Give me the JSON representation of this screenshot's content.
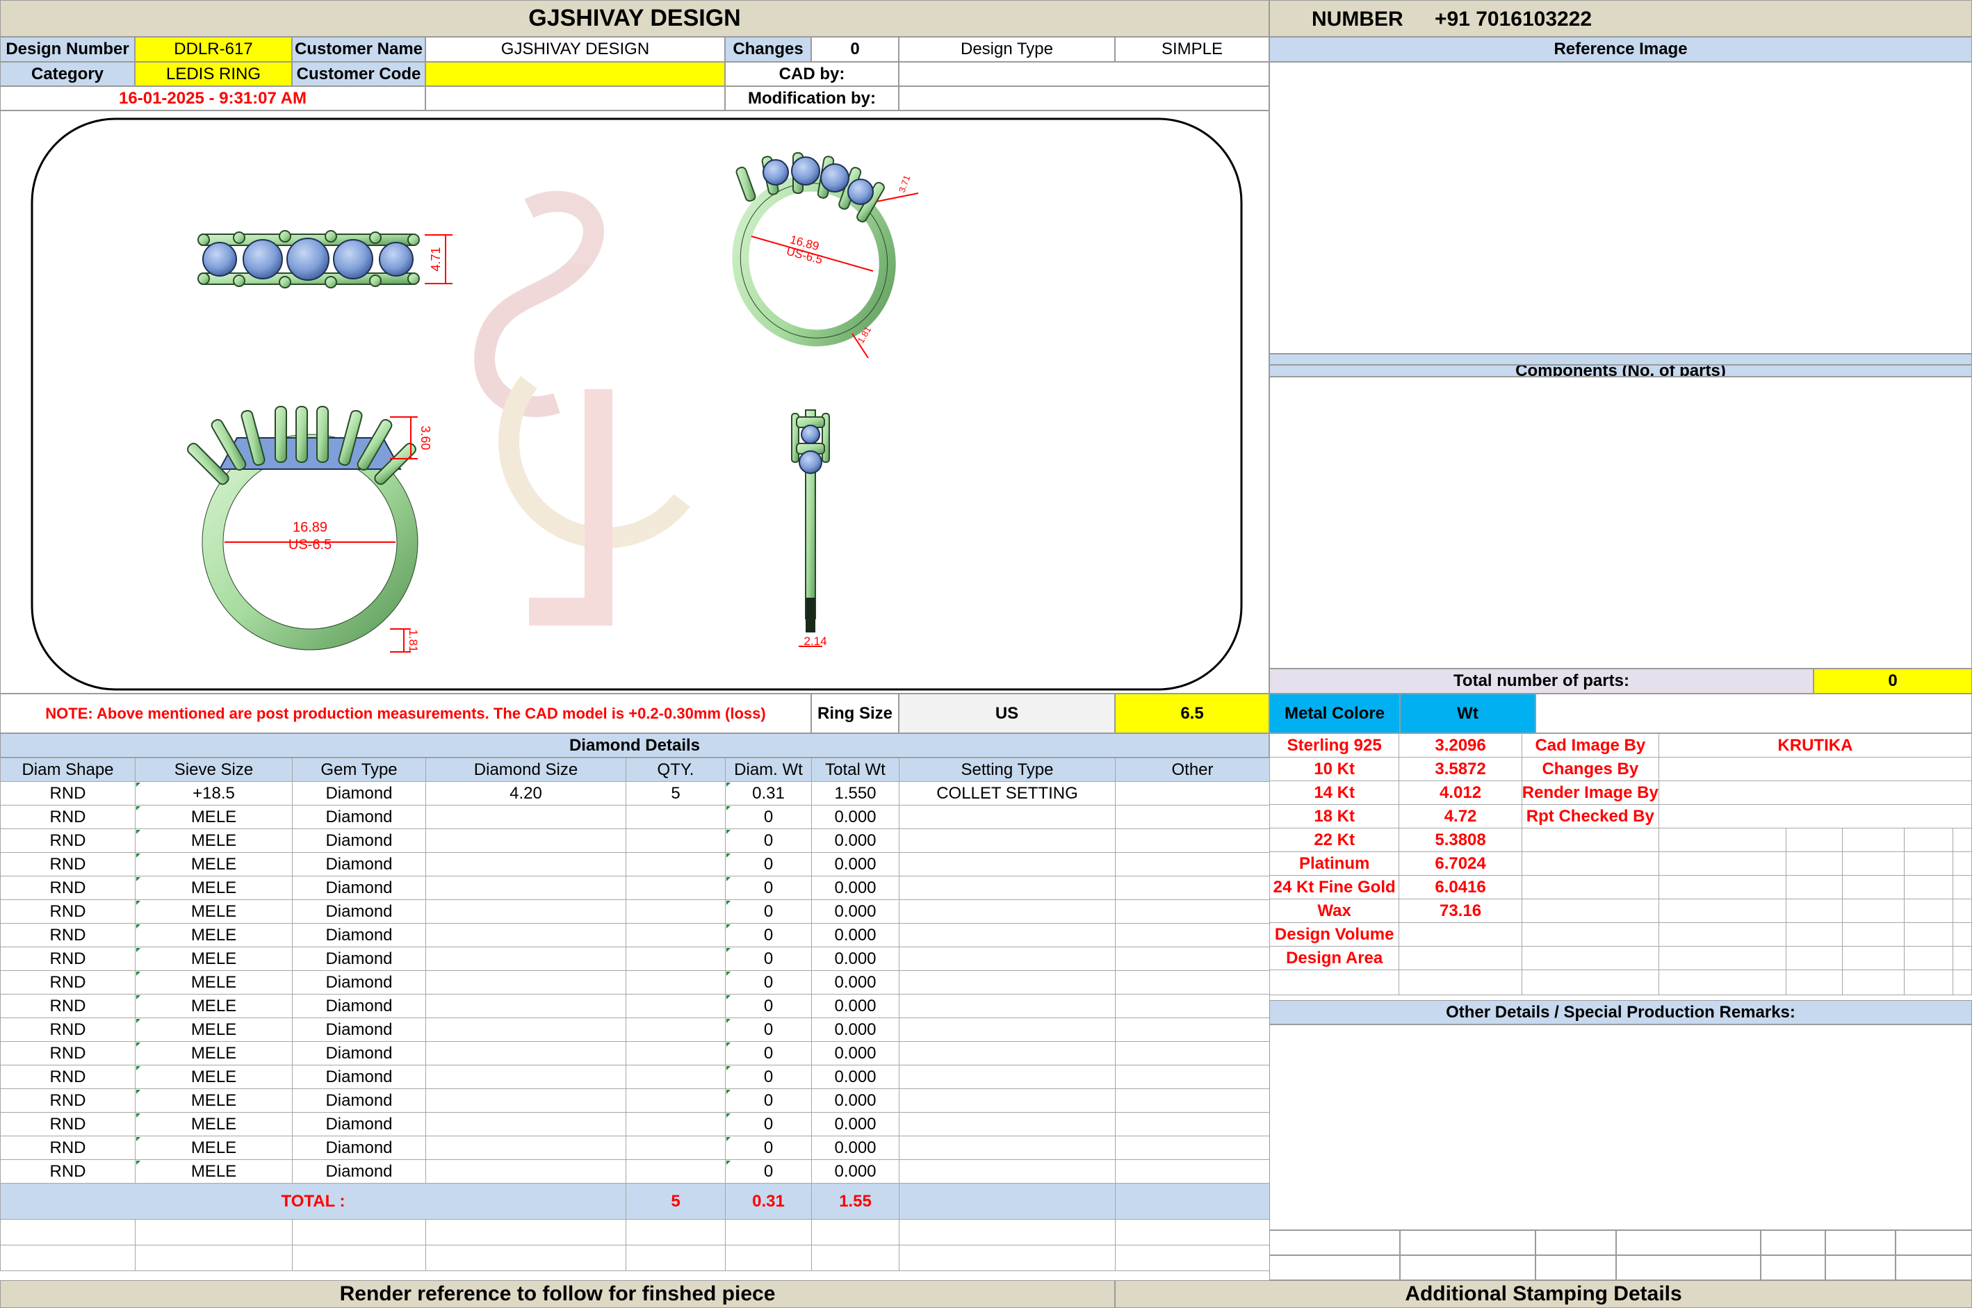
{
  "header": {
    "company": "GJSHIVAY DESIGN",
    "number_label": "NUMBER",
    "number_value": "+91 7016103222"
  },
  "info": {
    "design_number_label": "Design Number",
    "design_number": "DDLR-617",
    "customer_name_label": "Customer Name",
    "customer_name": "GJSHIVAY DESIGN",
    "changes_label": "Changes",
    "changes": "0",
    "design_type_label": "Design Type",
    "design_type": "SIMPLE",
    "category_label": "Category",
    "category": "LEDIS RING",
    "customer_code_label": "Customer Code",
    "customer_code": "",
    "cad_by_label": "CAD by:",
    "cad_by": "",
    "modification_label": "Modification by:",
    "modification": "",
    "datetime": "16-01-2025 - 9:31:07 AM"
  },
  "cad_labels": {
    "top_height": "4.71",
    "persp_diameter": "16.89",
    "persp_size": "US-6.5",
    "front_height": "3.60",
    "front_diameter": "16.89",
    "front_size": "US-6.5",
    "front_shank": "1.81",
    "side_width": "2.14",
    "persp_small": "1.81",
    "persp_tiny": "3.71"
  },
  "right_panel": {
    "reference_image": "Reference Image",
    "components": "Components (No. of parts)",
    "total_parts_label": "Total number of parts:",
    "total_parts": "0",
    "other_details": "Other Details / Special Production Remarks:"
  },
  "note": "NOTE: Above mentioned are post production measurements. The CAD model is +0.2-0.30mm (loss)",
  "ring_size": {
    "label": "Ring Size",
    "unit": "US",
    "value": "6.5"
  },
  "diamond": {
    "title": "Diamond Details",
    "headers": [
      "Diam Shape",
      "Sieve Size",
      "Gem Type",
      "Diamond Size",
      "QTY.",
      "Diam. Wt",
      "Total Wt",
      "Setting Type",
      "Other"
    ],
    "rows": [
      [
        "RND",
        "+18.5",
        "Diamond",
        "4.20",
        "5",
        "0.31",
        "1.550",
        "COLLET SETTING",
        ""
      ],
      [
        "RND",
        "MELE",
        "Diamond",
        "",
        "",
        "0",
        "0.000",
        "",
        ""
      ],
      [
        "RND",
        "MELE",
        "Diamond",
        "",
        "",
        "0",
        "0.000",
        "",
        ""
      ],
      [
        "RND",
        "MELE",
        "Diamond",
        "",
        "",
        "0",
        "0.000",
        "",
        ""
      ],
      [
        "RND",
        "MELE",
        "Diamond",
        "",
        "",
        "0",
        "0.000",
        "",
        ""
      ],
      [
        "RND",
        "MELE",
        "Diamond",
        "",
        "",
        "0",
        "0.000",
        "",
        ""
      ],
      [
        "RND",
        "MELE",
        "Diamond",
        "",
        "",
        "0",
        "0.000",
        "",
        ""
      ],
      [
        "RND",
        "MELE",
        "Diamond",
        "",
        "",
        "0",
        "0.000",
        "",
        ""
      ],
      [
        "RND",
        "MELE",
        "Diamond",
        "",
        "",
        "0",
        "0.000",
        "",
        ""
      ],
      [
        "RND",
        "MELE",
        "Diamond",
        "",
        "",
        "0",
        "0.000",
        "",
        ""
      ],
      [
        "RND",
        "MELE",
        "Diamond",
        "",
        "",
        "0",
        "0.000",
        "",
        ""
      ],
      [
        "RND",
        "MELE",
        "Diamond",
        "",
        "",
        "0",
        "0.000",
        "",
        ""
      ],
      [
        "RND",
        "MELE",
        "Diamond",
        "",
        "",
        "0",
        "0.000",
        "",
        ""
      ],
      [
        "RND",
        "MELE",
        "Diamond",
        "",
        "",
        "0",
        "0.000",
        "",
        ""
      ],
      [
        "RND",
        "MELE",
        "Diamond",
        "",
        "",
        "0",
        "0.000",
        "",
        ""
      ],
      [
        "RND",
        "MELE",
        "Diamond",
        "",
        "",
        "0",
        "0.000",
        "",
        ""
      ],
      [
        "RND",
        "MELE",
        "Diamond",
        "",
        "",
        "0",
        "0.000",
        "",
        ""
      ]
    ],
    "total_label": "TOTAL :",
    "total_qty": "5",
    "total_diam_wt": "0.31",
    "total_wt": "1.55"
  },
  "metal": {
    "header_label": "Metal Colore",
    "header_wt": "Wt",
    "rows": [
      [
        "Sterling 925",
        "3.2096"
      ],
      [
        "10 Kt",
        "3.5872"
      ],
      [
        "14 Kt",
        "4.012"
      ],
      [
        "18 Kt",
        "4.72"
      ],
      [
        "22 Kt",
        "5.3808"
      ],
      [
        "Platinum",
        "6.7024"
      ],
      [
        "24 Kt Fine Gold",
        "6.0416"
      ],
      [
        "Wax",
        "73.16"
      ],
      [
        "Design Volume",
        ""
      ],
      [
        "Design Area",
        ""
      ]
    ],
    "credits": [
      [
        "Cad Image By",
        "KRUTIKA"
      ],
      [
        "Changes By",
        ""
      ],
      [
        "Render Image By",
        ""
      ],
      [
        "Rpt Checked By",
        ""
      ]
    ]
  },
  "footer": {
    "render_reference": "Render reference to follow for finshed piece",
    "additional_stamping": "Additional Stamping Details"
  },
  "colors": {
    "ring_metal": "#a8dca0",
    "stone": "#7f9fd8",
    "dimension": "#ff0000",
    "header_beige": "#ddd9c4",
    "section_blue": "#c7d9ee",
    "highlight_yellow": "#ffff00",
    "metal_cyan": "#00b0f0"
  }
}
